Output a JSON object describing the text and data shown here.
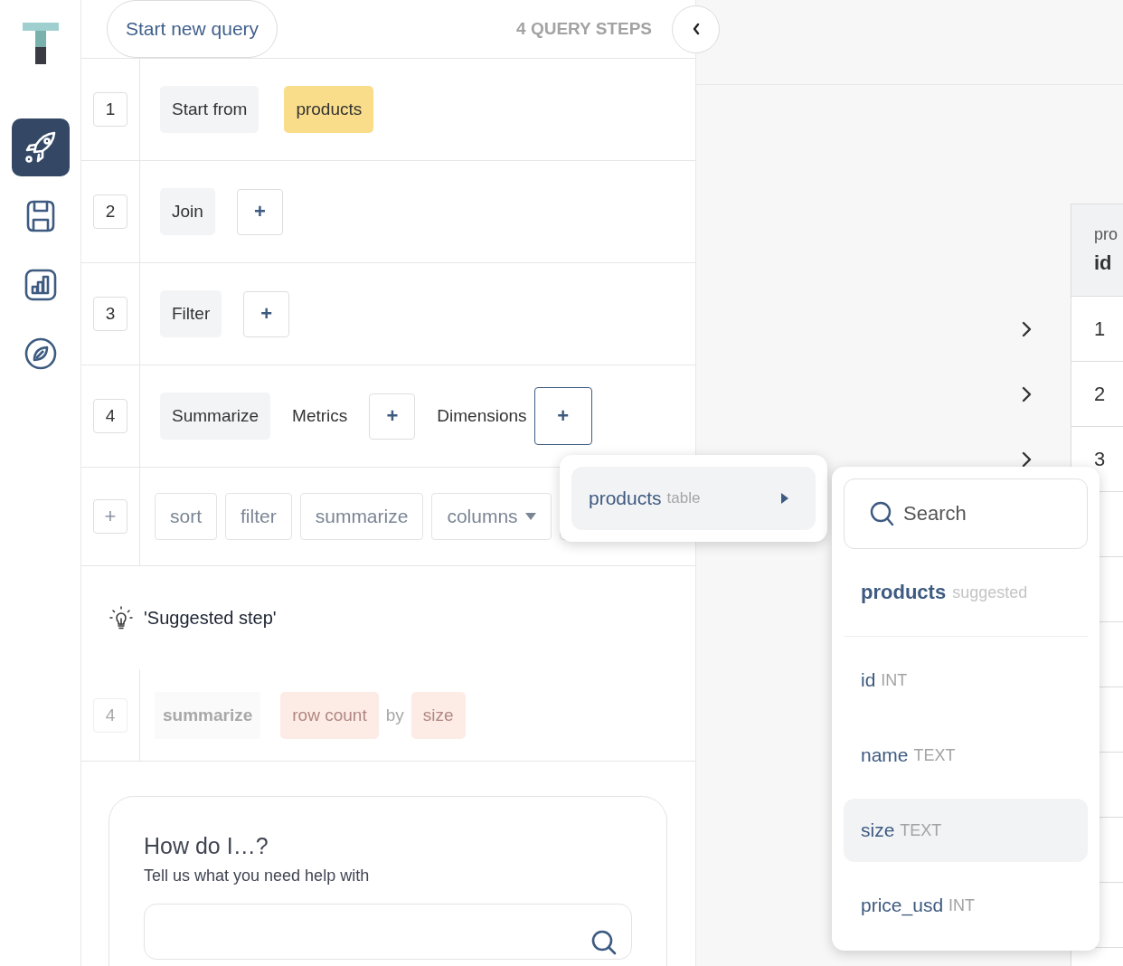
{
  "sidebar": {
    "nav": [
      {
        "kind": "rocket",
        "selected": true
      },
      {
        "kind": "save",
        "selected": false
      },
      {
        "kind": "chart",
        "selected": false
      },
      {
        "kind": "compass",
        "selected": false
      }
    ]
  },
  "header": {
    "new_query": "Start new query",
    "steps_count": "4 QUERY STEPS"
  },
  "steps": [
    {
      "number": "1",
      "parts": [
        {
          "kind": "chip",
          "text": "Start from"
        },
        {
          "kind": "table",
          "text": "products"
        }
      ]
    },
    {
      "number": "2",
      "parts": [
        {
          "kind": "chip",
          "text": "Join"
        },
        {
          "kind": "add",
          "text": "+",
          "active": false
        }
      ]
    },
    {
      "number": "3",
      "parts": [
        {
          "kind": "chip",
          "text": "Filter"
        },
        {
          "kind": "add",
          "text": "+",
          "active": false
        }
      ]
    },
    {
      "number": "4",
      "parts": [
        {
          "kind": "chip",
          "text": "Summarize"
        },
        {
          "kind": "label",
          "text": "Metrics"
        },
        {
          "kind": "add",
          "text": "+",
          "active": false
        },
        {
          "kind": "label",
          "text": "Dimensions"
        },
        {
          "kind": "add",
          "text": "+",
          "active": true
        }
      ]
    }
  ],
  "add_step": {
    "button": "+",
    "actions": [
      {
        "label": "sort",
        "dropdown": false
      },
      {
        "label": "filter",
        "dropdown": false
      },
      {
        "label": "summarize",
        "dropdown": false
      },
      {
        "label": "columns",
        "dropdown": true
      }
    ]
  },
  "suggestion": {
    "title": "'Suggested step'",
    "number": "4",
    "parts": [
      {
        "kind": "command",
        "text": "summarize"
      },
      {
        "kind": "metric",
        "text": "row count"
      },
      {
        "kind": "word",
        "text": "by"
      },
      {
        "kind": "field",
        "text": "size"
      }
    ]
  },
  "help": {
    "title": "How do I…?",
    "subtitle": "Tell us what you need help with"
  },
  "results": {
    "header_top": "pro",
    "header": "id",
    "rows": [
      {
        "cell": "1"
      },
      {
        "cell": "2"
      },
      {
        "cell": "3"
      }
    ]
  },
  "table_menu": {
    "items": [
      {
        "name": "products",
        "note": "table",
        "selected": true
      }
    ]
  },
  "column_menu": {
    "search": {
      "placeholder": "Search"
    },
    "group": {
      "name": "products",
      "note": "suggested"
    },
    "columns": [
      {
        "name": "id",
        "type": "INT",
        "selected": false
      },
      {
        "name": "name",
        "type": "TEXT",
        "selected": false
      },
      {
        "name": "size",
        "type": "TEXT",
        "selected": true
      },
      {
        "name": "price_usd",
        "type": "INT",
        "selected": false
      }
    ]
  }
}
